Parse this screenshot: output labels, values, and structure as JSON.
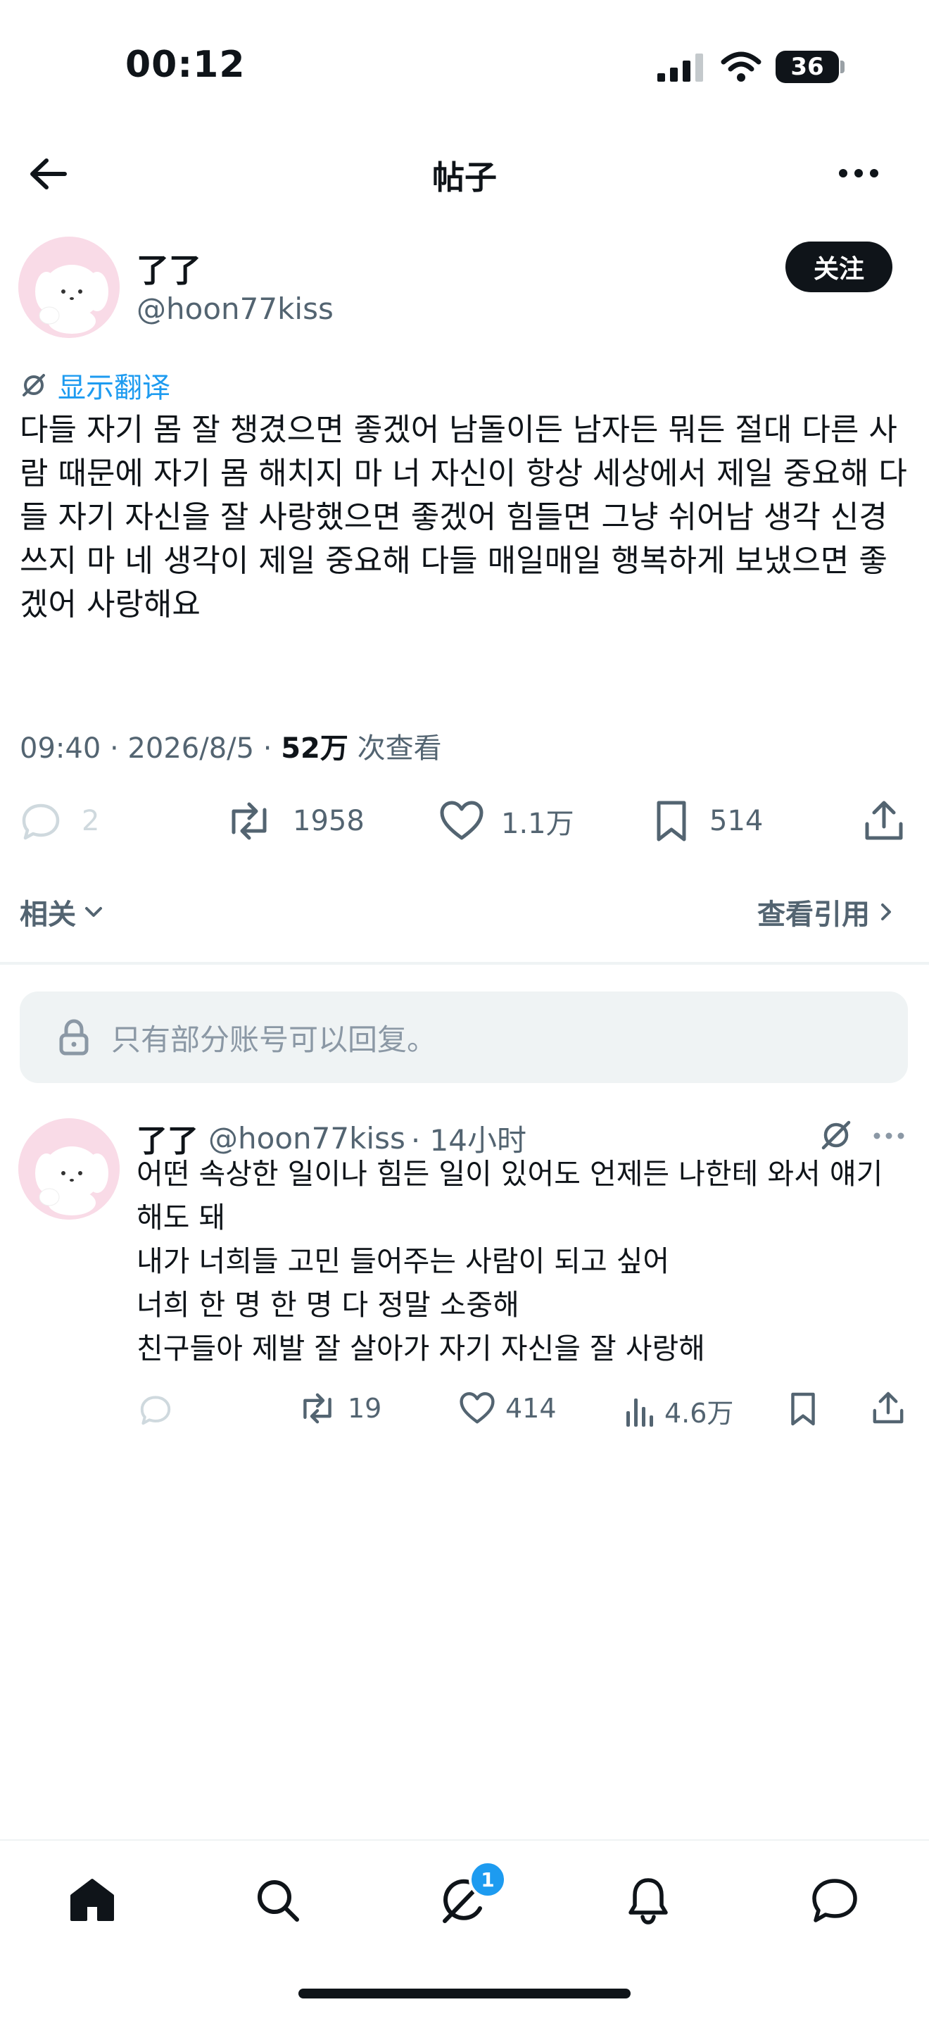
{
  "status_bar": {
    "time": "00:12",
    "battery": "36"
  },
  "header": {
    "title": "帖子"
  },
  "post": {
    "display_name": "了了",
    "handle": "@hoon77kiss",
    "follow_label": "关注",
    "translate_label": "显示翻译",
    "text": "다들 자기 몸 잘 챙겼으면 좋겠어 남돌이든 남자든 뭐든 절대 다른 사람 때문에 자기 몸 해치지 마 너 자신이 항상 세상에서 제일 중요해 다들 자기 자신을 잘 사랑했으면 좋겠어 힘들면 그냥 쉬어남 생각 신경 쓰지 마 네 생각이 제일 중요해 다들 매일매일 행복하게 보냈으면 좋겠어 사랑해요",
    "meta_time": "09:40 · 2026/8/5 · ",
    "views_count": "52万",
    "views_label": " 次查看",
    "stats": {
      "replies": "2",
      "reposts": "1958",
      "likes": "1.1万",
      "bookmarks": "514"
    }
  },
  "related_label": "相关",
  "quotes_label": "查看引用",
  "reply_restriction": "只有部分账号可以回复。",
  "reply": {
    "display_name": "了了",
    "handle": "@hoon77kiss",
    "time": "· 14小时",
    "lines": [
      "어떤 속상한 일이나 힘든 일이 있어도 언제든 나한테 와서 얘기해도 돼",
      "내가 너희들 고민 들어주는 사람이 되고 싶어",
      "너희 한 명 한 명 다 정말 소중해",
      "친구들아 제발 잘 살아가 자기 자신을 잘 사랑해"
    ],
    "stats": {
      "reposts": "19",
      "likes": "414",
      "views": "4.6万"
    }
  },
  "tabbar": {
    "messages_badge": "1"
  },
  "colors": {
    "accent": "#1d9bf0",
    "text": "#0f1419",
    "muted": "#536471",
    "divider": "#eff3f4"
  },
  "icons": [
    "back-arrow-icon",
    "more-icon",
    "translate-icon",
    "reply-icon",
    "repost-icon",
    "like-icon",
    "bookmark-icon",
    "share-icon",
    "chevron-down-icon",
    "chevron-right-icon",
    "lock-icon",
    "views-icon",
    "home-icon",
    "search-icon",
    "grok-icon",
    "bell-icon",
    "messages-icon"
  ]
}
